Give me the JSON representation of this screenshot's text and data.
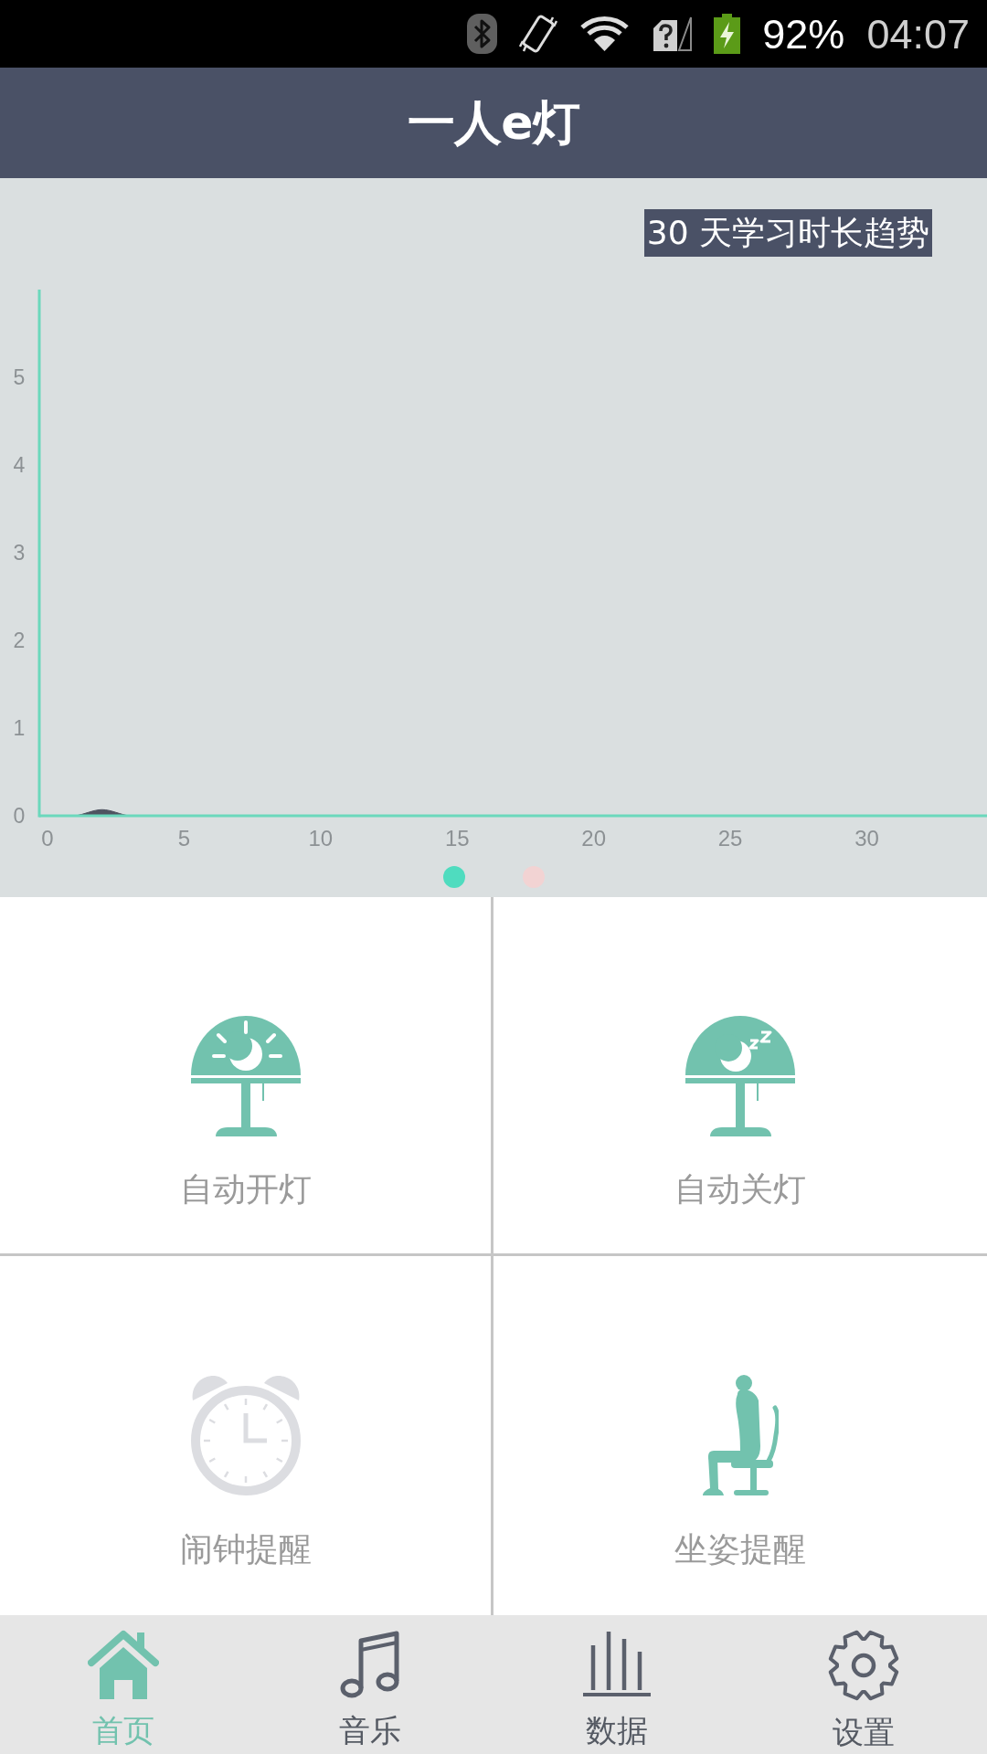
{
  "status_bar": {
    "battery": "92%",
    "time": "04:07"
  },
  "header": {
    "title": "一人e灯"
  },
  "trend_chart": {
    "chart_data": {
      "type": "area",
      "title": "30 天学习时长趋势",
      "x": [
        0,
        1,
        2,
        3,
        4,
        5,
        6,
        7,
        8,
        9,
        10,
        11,
        12,
        13,
        14,
        15,
        16,
        17,
        18,
        19,
        20,
        21,
        22,
        23,
        24,
        25,
        26,
        27,
        28,
        29,
        30
      ],
      "values": [
        0,
        0,
        0.07,
        0,
        0,
        0,
        0,
        0,
        0,
        0,
        0,
        0,
        0,
        0,
        0,
        0,
        0,
        0,
        0,
        0,
        0,
        0,
        0,
        0,
        0,
        0,
        0,
        0,
        0,
        0,
        0
      ],
      "xlim": [
        -0.3,
        34.4
      ],
      "ylim": [
        0,
        6
      ],
      "xticks": [
        0,
        5,
        10,
        15,
        20,
        25,
        30
      ],
      "yticks": [
        0,
        1,
        2,
        3,
        4,
        5
      ]
    }
  },
  "pager": [
    {
      "selected": true
    },
    {
      "selected": false
    }
  ],
  "tiles": [
    {
      "kind": "wake",
      "label": "自动开灯",
      "on": true
    },
    {
      "kind": "sleep",
      "label": "自动关灯",
      "on": true
    },
    {
      "kind": "alarm",
      "label": "闹钟提醒",
      "on": false
    },
    {
      "kind": "posture",
      "label": "坐姿提醒",
      "on": true
    }
  ],
  "bottom_nav": [
    {
      "kind": "home",
      "label": "首页",
      "selected": true
    },
    {
      "kind": "music",
      "label": "音乐",
      "selected": false
    },
    {
      "kind": "data",
      "label": "数据",
      "selected": false
    },
    {
      "kind": "settings",
      "label": "设置",
      "selected": false
    }
  ]
}
